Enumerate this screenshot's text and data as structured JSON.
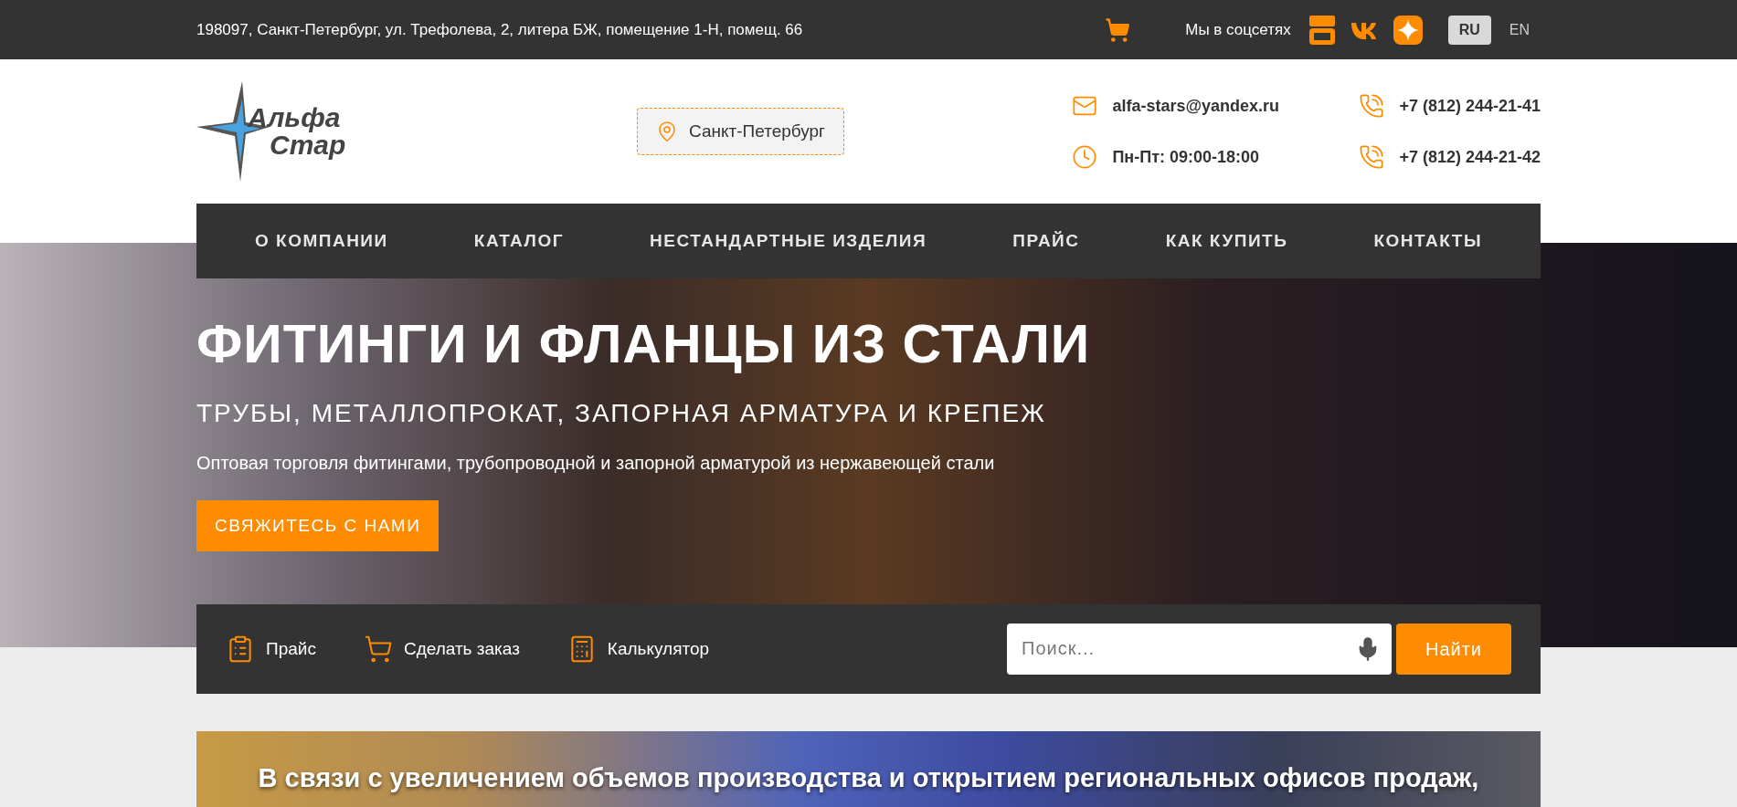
{
  "top_bar": {
    "address": "198097, Санкт-Петербург, ул. Трефолева, 2, литера БЖ, помещение 1-Н, помещ. 66",
    "social_label": "Мы в соцсетях",
    "languages": [
      {
        "label": "RU",
        "selected": true
      },
      {
        "label": "EN",
        "selected": false
      }
    ]
  },
  "header": {
    "logo": {
      "line_1": "Альфа",
      "line_2": "Стар"
    },
    "city": "Санкт-Петербург",
    "contacts": [
      {
        "kind": "email",
        "text": "alfa-stars@yandex.ru"
      },
      {
        "kind": "phone",
        "text": "+7 (812) 244-21-41"
      },
      {
        "kind": "hours",
        "text": "Пн-Пт: 09:00-18:00"
      },
      {
        "kind": "phone",
        "text": "+7 (812) 244-21-42"
      }
    ]
  },
  "nav": [
    "О КОМПАНИИ",
    "КАТАЛОГ",
    "НЕСТАНДАРТНЫЕ ИЗДЕЛИЯ",
    "ПРАЙС",
    "КАК КУПИТЬ",
    "КОНТАКТЫ"
  ],
  "hero": {
    "title": "ФИТИНГИ И ФЛАНЦЫ ИЗ СТАЛИ",
    "subtitle": "ТРУБЫ, МЕТАЛЛОПРОКАТ, ЗАПОРНАЯ АРМАТУРА И КРЕПЕЖ",
    "description": "Оптовая торговля фитингами, трубопроводной и запорной арматурой из нержавеющей стали",
    "button": "СВЯЖИТЕСЬ С НАМИ"
  },
  "toolbar": {
    "links": [
      {
        "kind": "price",
        "label": "Прайс"
      },
      {
        "kind": "order",
        "label": "Сделать заказ"
      },
      {
        "kind": "calculator",
        "label": "Калькулятор"
      }
    ],
    "search": {
      "placeholder": "Поиск..."
    },
    "search_button": "Найти"
  },
  "banner": {
    "text": "В связи с увеличением объемов производства и открытием региональных офисов продаж,"
  }
}
